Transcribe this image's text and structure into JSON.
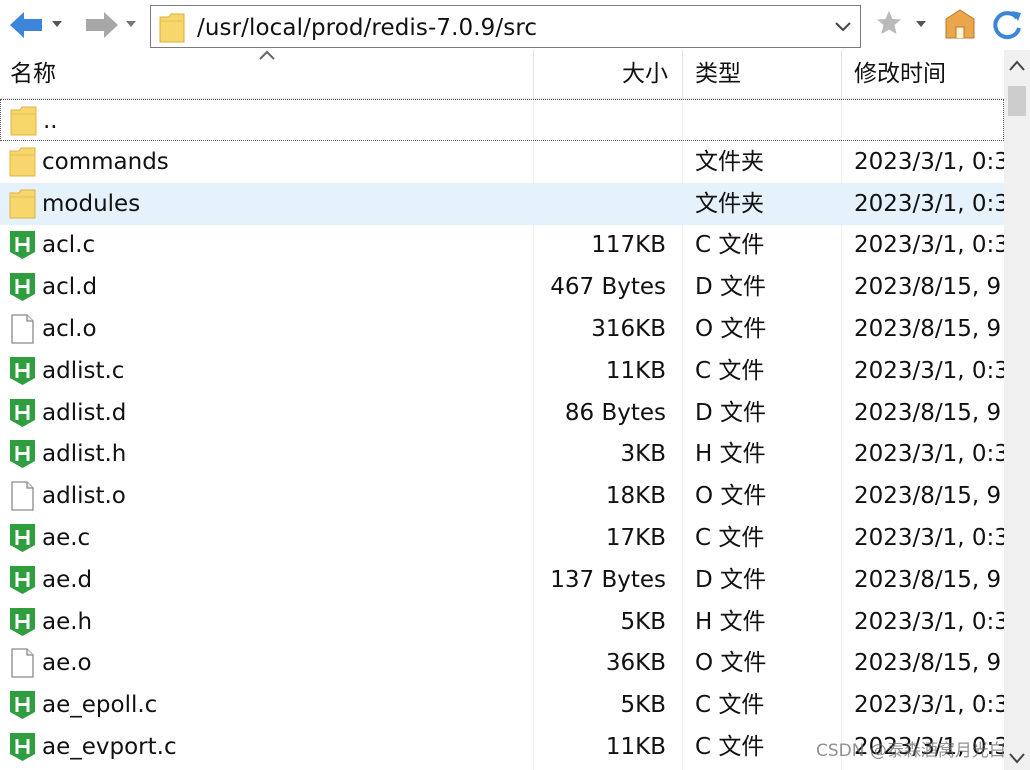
{
  "address": {
    "path": "/usr/local/prod/redis-7.0.9/src"
  },
  "columns": {
    "name": "名称",
    "size": "大小",
    "type": "类型",
    "modified": "修改时间"
  },
  "files": [
    {
      "icon": "folder-icon",
      "name": "..",
      "size": "",
      "type": "",
      "modified": ""
    },
    {
      "icon": "folder-icon",
      "name": "commands",
      "size": "",
      "type": "文件夹",
      "modified": "2023/3/1, 0:3"
    },
    {
      "icon": "folder-icon",
      "name": "modules",
      "size": "",
      "type": "文件夹",
      "modified": "2023/3/1, 0:3"
    },
    {
      "icon": "source-file-icon",
      "name": "acl.c",
      "size": "117KB",
      "type": "C 文件",
      "modified": "2023/3/1, 0:3"
    },
    {
      "icon": "source-file-icon",
      "name": "acl.d",
      "size": "467 Bytes",
      "type": "D 文件",
      "modified": "2023/8/15, 9"
    },
    {
      "icon": "blank-file-icon",
      "name": "acl.o",
      "size": "316KB",
      "type": "O 文件",
      "modified": "2023/8/15, 9"
    },
    {
      "icon": "source-file-icon",
      "name": "adlist.c",
      "size": "11KB",
      "type": "C 文件",
      "modified": "2023/3/1, 0:3"
    },
    {
      "icon": "source-file-icon",
      "name": "adlist.d",
      "size": "86 Bytes",
      "type": "D 文件",
      "modified": "2023/8/15, 9"
    },
    {
      "icon": "source-file-icon",
      "name": "adlist.h",
      "size": "3KB",
      "type": "H 文件",
      "modified": "2023/3/1, 0:3"
    },
    {
      "icon": "blank-file-icon",
      "name": "adlist.o",
      "size": "18KB",
      "type": "O 文件",
      "modified": "2023/8/15, 9"
    },
    {
      "icon": "source-file-icon",
      "name": "ae.c",
      "size": "17KB",
      "type": "C 文件",
      "modified": "2023/3/1, 0:3"
    },
    {
      "icon": "source-file-icon",
      "name": "ae.d",
      "size": "137 Bytes",
      "type": "D 文件",
      "modified": "2023/8/15, 9"
    },
    {
      "icon": "source-file-icon",
      "name": "ae.h",
      "size": "5KB",
      "type": "H 文件",
      "modified": "2023/3/1, 0:3"
    },
    {
      "icon": "blank-file-icon",
      "name": "ae.o",
      "size": "36KB",
      "type": "O 文件",
      "modified": "2023/8/15, 9"
    },
    {
      "icon": "source-file-icon",
      "name": "ae_epoll.c",
      "size": "5KB",
      "type": "C 文件",
      "modified": "2023/3/1, 0:3"
    },
    {
      "icon": "source-file-icon",
      "name": "ae_evport.c",
      "size": "11KB",
      "type": "C 文件",
      "modified": "2023/3/1, 0:3"
    }
  ],
  "selected_index": 2,
  "focused_index": 0,
  "watermark": "CSDN @泰森酒窝月光白",
  "colors": {
    "selection": "#e5f1fb",
    "folder": "#f7d66b",
    "source_icon": "#2f9e3f",
    "nav_arrow": "#3b86d8"
  }
}
